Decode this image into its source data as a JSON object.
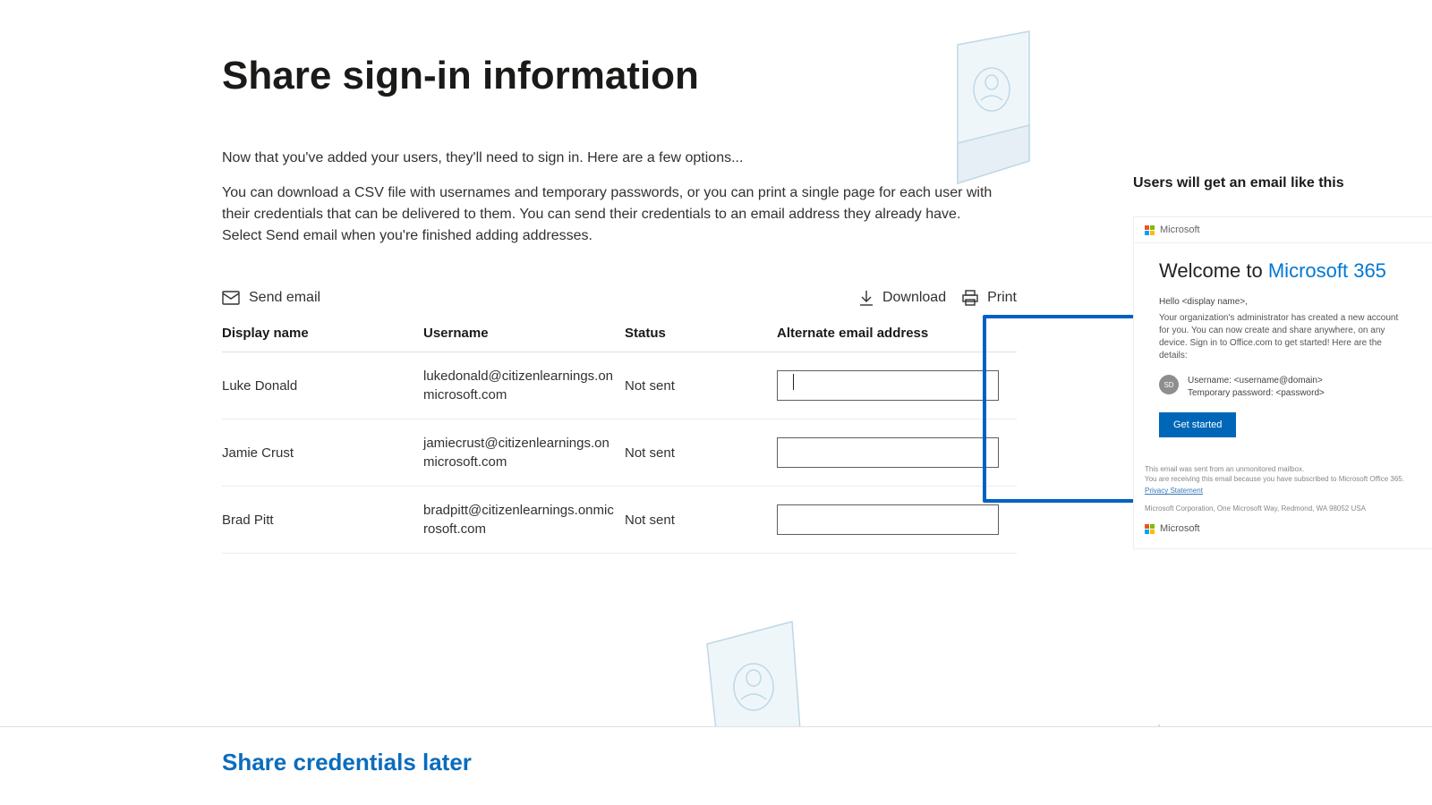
{
  "page": {
    "title": "Share sign-in information",
    "intro1": "Now that you've added your users, they'll need to sign in. Here are a few options...",
    "intro2": "You can download a CSV file with usernames and temporary passwords, or you can print a single page for each user with their credentials that can be delivered to them. You can send their credentials to an email address they already have. Select Send email when you're finished adding addresses."
  },
  "actions": {
    "send_email": "Send email",
    "download": "Download",
    "print": "Print"
  },
  "table": {
    "headers": {
      "display_name": "Display name",
      "username": "Username",
      "status": "Status",
      "alternate_email": "Alternate email address"
    },
    "rows": [
      {
        "display_name": "Luke Donald",
        "username": "lukedonald@citizenlearnings.onmicrosoft.com",
        "status": "Not sent",
        "alt_email": ""
      },
      {
        "display_name": "Jamie Crust",
        "username": "jamiecrust@citizenlearnings.onmicrosoft.com",
        "status": "Not sent",
        "alt_email": ""
      },
      {
        "display_name": "Brad Pitt",
        "username": "bradpitt@citizenlearnings.onmicrosoft.com",
        "status": "Not sent",
        "alt_email": ""
      }
    ]
  },
  "footer": {
    "share_later": "Share credentials later"
  },
  "preview": {
    "heading": "Users will get an email like this",
    "brand_label": "Microsoft",
    "welcome_prefix": "Welcome to ",
    "welcome_brand": "Microsoft 365",
    "hello": "Hello <display name>,",
    "desc": "Your organization's administrator has created a new account for you. You can now create and share anywhere, on any device. Sign in to Office.com to get started! Here are the details:",
    "avatar_initials": "SD",
    "username_line": "Username: <username@domain>",
    "password_line": "Temporary password: <password>",
    "get_started": "Get started",
    "footer_line1": "This email was sent from an unmonitored mailbox.",
    "footer_line2": "You are receiving this email because you have subscribed to Microsoft Office 365.",
    "privacy": "Privacy Statement",
    "corp_line": "Microsoft Corporation, One Microsoft Way, Redmond, WA 98052 USA",
    "footer_brand": "Microsoft"
  }
}
